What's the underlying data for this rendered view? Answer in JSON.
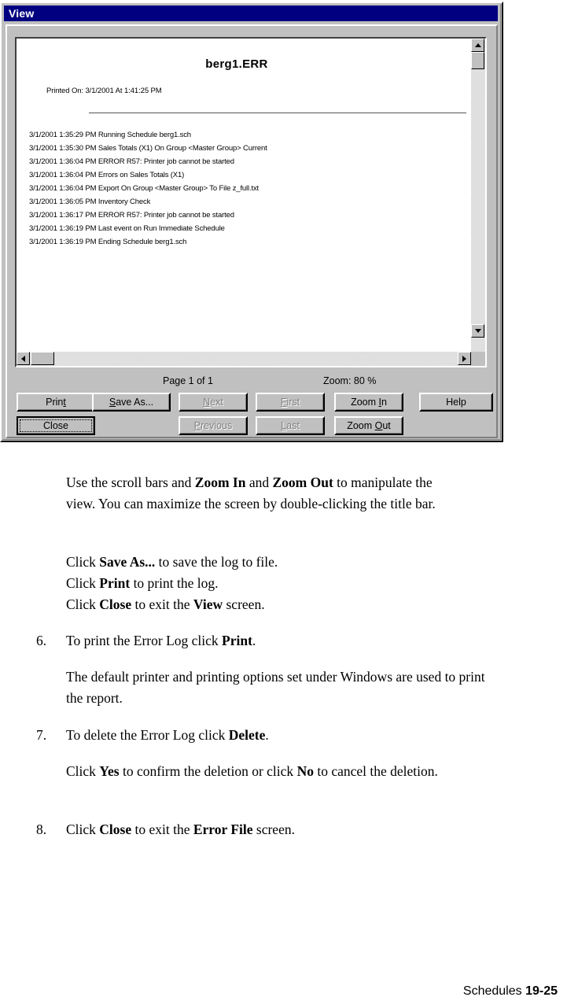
{
  "window": {
    "title": "View",
    "preview": {
      "document_title": "berg1.ERR",
      "printed_on": "Printed On: 3/1/2001 At 1:41:25 PM",
      "log_lines": [
        "3/1/2001 1:35:29 PM Running Schedule berg1.sch",
        "3/1/2001 1:35:30 PM Sales Totals (X1) On Group <Master Group> Current",
        "3/1/2001 1:36:04 PM ERROR R57: Printer job cannot be started",
        "3/1/2001 1:36:04 PM Errors on Sales Totals (X1)",
        "3/1/2001 1:36:04 PM Export On Group <Master Group> To File z_full.txt",
        "3/1/2001 1:36:05 PM Inventory Check",
        "3/1/2001 1:36:17 PM ERROR R57: Printer job cannot be started",
        "3/1/2001 1:36:19 PM Last event on Run Immediate Schedule",
        "3/1/2001 1:36:19 PM Ending Schedule berg1.sch"
      ]
    },
    "status": {
      "page_info": "Page 1 of 1",
      "zoom_info": "Zoom: 80 %"
    },
    "buttons": {
      "print": "Print",
      "save_as": "Save As...",
      "next": "Next",
      "first": "First",
      "zoom_in": "Zoom In",
      "help": "Help",
      "close": "Close",
      "previous": "Previous",
      "last": "Last",
      "zoom_out": "Zoom Out"
    },
    "scrollbars": {
      "up_icon": "arrow-up-icon",
      "down_icon": "arrow-down-icon",
      "left_icon": "arrow-left-icon",
      "right_icon": "arrow-right-icon"
    },
    "colors": {
      "titlebar": "#000080",
      "face": "#c0c0c0",
      "disabled_text": "#808080"
    }
  },
  "document": {
    "paragraphs": [
      {
        "id": "p-scrollbars",
        "runs": [
          {
            "t": "Use the scroll bars and ",
            "b": false
          },
          {
            "t": "Zoom In",
            "b": true
          },
          {
            "t": " and ",
            "b": false
          },
          {
            "t": "Zoom Out",
            "b": true
          },
          {
            "t": " to manipulate the view. You can maximize the screen by double-clicking the title bar.",
            "b": false
          }
        ]
      },
      {
        "id": "p-saveas",
        "runs": [
          {
            "t": "Click ",
            "b": false
          },
          {
            "t": "Save As...",
            "b": true
          },
          {
            "t": " to save the log to file.",
            "b": false
          }
        ]
      },
      {
        "id": "p-print",
        "runs": [
          {
            "t": "Click ",
            "b": false
          },
          {
            "t": "Print",
            "b": true
          },
          {
            "t": " to print the log.",
            "b": false
          }
        ]
      },
      {
        "id": "p-close",
        "runs": [
          {
            "t": "Click ",
            "b": false
          },
          {
            "t": "Close",
            "b": true
          },
          {
            "t": " to exit the ",
            "b": false
          },
          {
            "t": "View",
            "b": true
          },
          {
            "t": " screen.",
            "b": false
          }
        ]
      },
      {
        "id": "step-6",
        "number": "6.",
        "runs": [
          {
            "t": "To print the Error Log click ",
            "b": false
          },
          {
            "t": "Print",
            "b": true
          },
          {
            "t": ".",
            "b": false
          }
        ]
      },
      {
        "id": "p-default-printer",
        "runs": [
          {
            "t": "The default printer and printing options set under Windows are used to print the report.",
            "b": false
          }
        ]
      },
      {
        "id": "step-7",
        "number": "7.",
        "runs": [
          {
            "t": "To delete the Error Log click ",
            "b": false
          },
          {
            "t": "Delete",
            "b": true
          },
          {
            "t": ".",
            "b": false
          }
        ]
      },
      {
        "id": "p-confirm",
        "runs": [
          {
            "t": "Click ",
            "b": false
          },
          {
            "t": "Yes",
            "b": true
          },
          {
            "t": " to confirm the deletion or click ",
            "b": false
          },
          {
            "t": "No",
            "b": true
          },
          {
            "t": " to cancel the deletion.",
            "b": false
          }
        ]
      },
      {
        "id": "step-8",
        "number": "8.",
        "runs": [
          {
            "t": "Click ",
            "b": false
          },
          {
            "t": "Close",
            "b": true
          },
          {
            "t": " to exit the ",
            "b": false
          },
          {
            "t": "Error File",
            "b": true
          },
          {
            "t": " screen.",
            "b": false
          }
        ]
      }
    ]
  },
  "footer": {
    "section": "Schedules",
    "page_number": "19-25"
  }
}
